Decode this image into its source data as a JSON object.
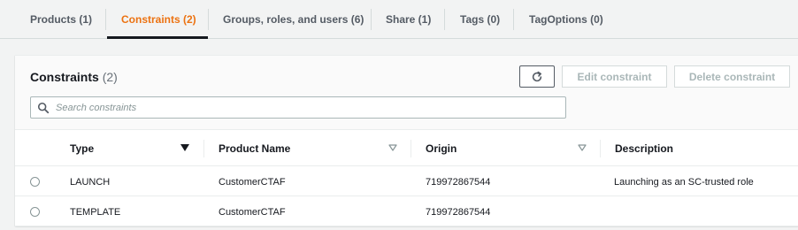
{
  "tabs": [
    {
      "label": "Products (1)"
    },
    {
      "label": "Constraints (2)"
    },
    {
      "label": "Groups, roles, and users (6)"
    },
    {
      "label": "Share (1)"
    },
    {
      "label": "Tags (0)"
    },
    {
      "label": "TagOptions (0)"
    }
  ],
  "active_tab": "Constraints (2)",
  "panel": {
    "title": "Constraints",
    "count": "(2)",
    "refresh_icon": "refresh-icon",
    "edit_label": "Edit constraint",
    "delete_label": "Delete constraint",
    "search_placeholder": "Search constraints",
    "search_value": ""
  },
  "table": {
    "columns": [
      {
        "label": "Type",
        "sort_icon": "caret-down-filled-icon"
      },
      {
        "label": "Product Name",
        "sort_icon": "caret-down-outline-icon"
      },
      {
        "label": "Origin",
        "sort_icon": "caret-down-outline-icon"
      },
      {
        "label": "Description",
        "sort_icon": ""
      }
    ],
    "rows": [
      {
        "type": "LAUNCH",
        "product_name": "CustomerCTAF",
        "origin": "719972867544",
        "description": "Launching as an SC-trusted role"
      },
      {
        "type": "TEMPLATE",
        "product_name": "CustomerCTAF",
        "origin": "719972867544",
        "description": ""
      }
    ]
  },
  "colors": {
    "accent": "#ec7211",
    "text": "#16191f",
    "muted": "#545b64",
    "disabled": "#aab7b8",
    "border": "#d5dbdb"
  }
}
